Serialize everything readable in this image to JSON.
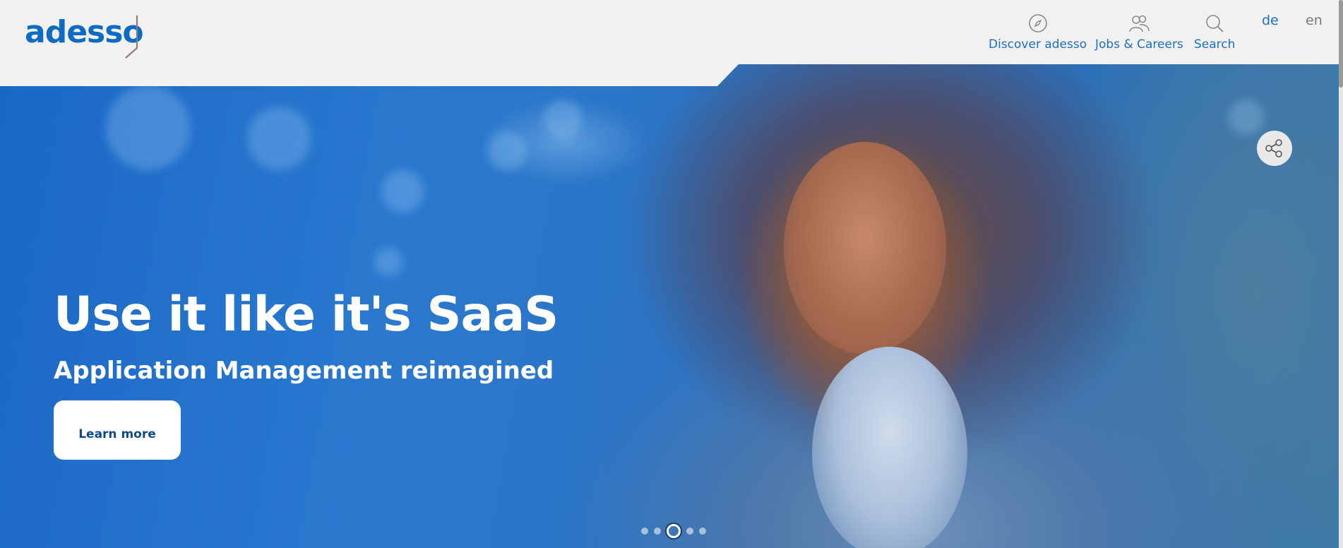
{
  "brand": {
    "logo_text": "adesso",
    "accent": "#1a6fc6"
  },
  "nav": {
    "items": [
      {
        "label": "Discover adesso",
        "icon": "compass-icon"
      },
      {
        "label": "Jobs & Careers",
        "icon": "people-icon"
      },
      {
        "label": "Search",
        "icon": "search-icon"
      }
    ],
    "languages": [
      {
        "code": "de",
        "active": true
      },
      {
        "code": "en",
        "active": false
      }
    ]
  },
  "hero": {
    "title": "Use it like it's SaaS",
    "subtitle": "Application Management reimagined",
    "cta_label": "Learn more",
    "share_icon": "share-icon",
    "carousel": {
      "total": 5,
      "active_index": 3
    }
  }
}
